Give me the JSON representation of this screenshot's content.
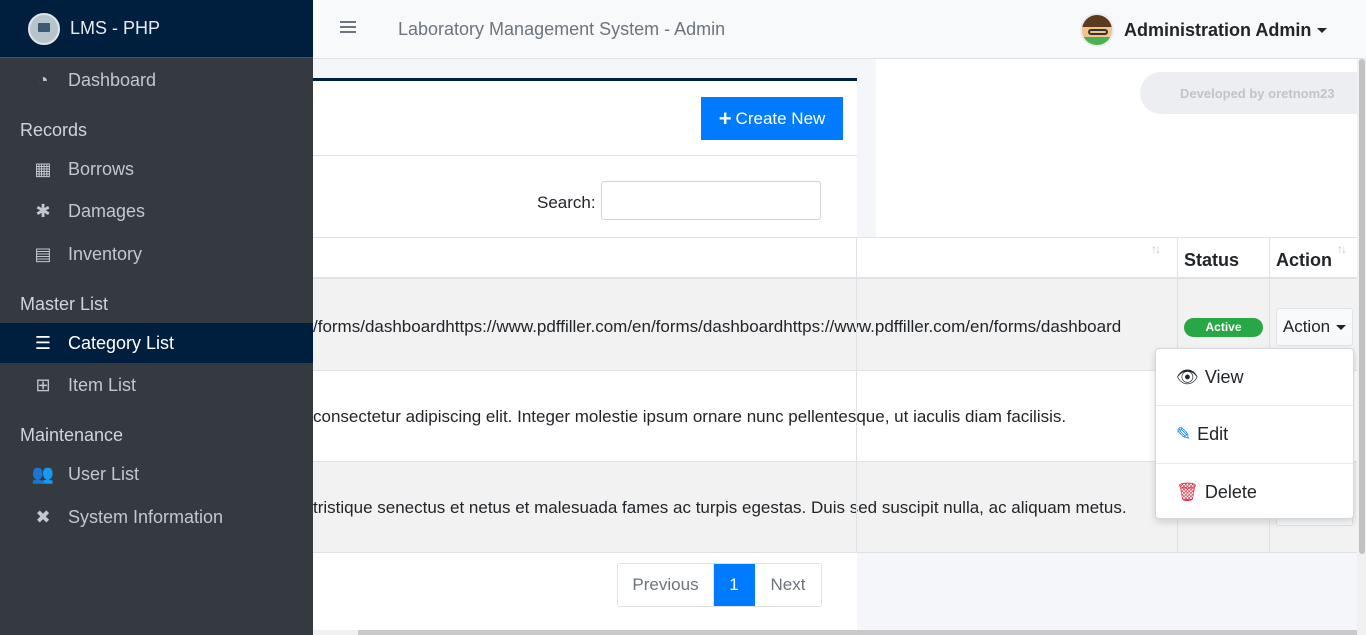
{
  "brand": {
    "name": "LMS - PHP"
  },
  "header": {
    "title": "Laboratory Management System - Admin",
    "user_name": "Administration Admin"
  },
  "credit": "Developed by oretnom23",
  "sidebar": {
    "items": [
      {
        "label": "Dashboard",
        "icon": "dashboard-icon"
      },
      {
        "label": "Borrows",
        "icon": "boxes-icon"
      },
      {
        "label": "Damages",
        "icon": "bug-icon"
      },
      {
        "label": "Inventory",
        "icon": "clipboard-icon"
      },
      {
        "label": "Category List",
        "icon": "table-icon",
        "active": true
      },
      {
        "label": "Item List",
        "icon": "grid-icon"
      },
      {
        "label": "User List",
        "icon": "users-icon"
      },
      {
        "label": "System Information",
        "icon": "tools-icon"
      }
    ],
    "headers": [
      "Records",
      "Master List",
      "Maintenance"
    ]
  },
  "card": {
    "create_label": "Create New",
    "search_label": "Search:"
  },
  "table": {
    "headers": {
      "status": "Status",
      "action": "Action"
    },
    "rows": [
      {
        "text": "/forms/dashboardhttps://www.pdffiller.com/en/forms/dashboardhttps://www.pdffiller.com/en/forms/dashboard",
        "status": "Active",
        "action": "Action"
      },
      {
        "text": "consectetur adipiscing elit. Integer molestie ipsum ornare nunc pellentesque, ut iaculis diam facilisis."
      },
      {
        "text": "tristique senectus et netus et malesuada fames ac turpis egestas. Duis sed suscipit nulla, ac aliquam metus."
      }
    ]
  },
  "dropdown": {
    "view": "View",
    "edit": "Edit",
    "delete": "Delete"
  },
  "pagination": {
    "previous": "Previous",
    "page": "1",
    "next": "Next"
  },
  "colors": {
    "primary": "#007bff",
    "sidebar": "#343a40",
    "brand": "#001f3f",
    "success": "#28a745",
    "danger": "#dc3545"
  }
}
